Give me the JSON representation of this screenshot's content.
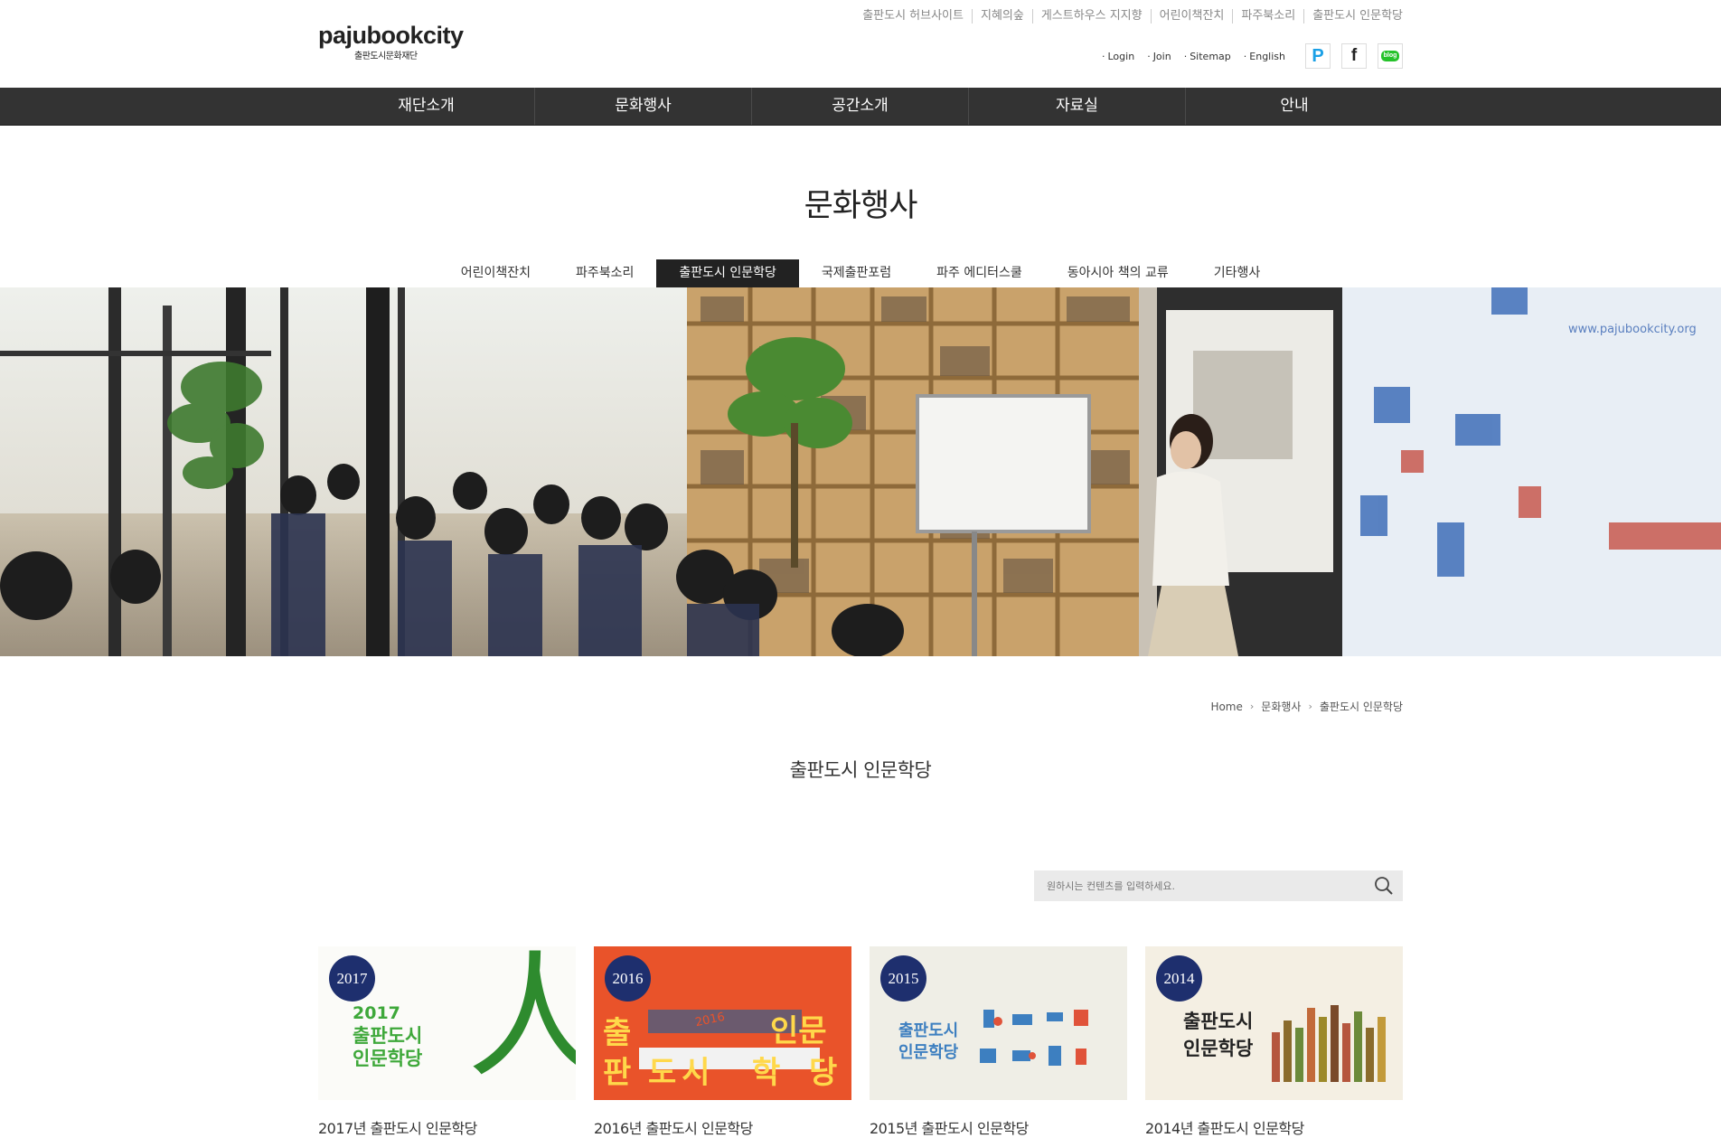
{
  "logo": {
    "main": "pajubookcity",
    "sub": "출판도시문화재단"
  },
  "top_links": [
    "출판도시 허브사이트",
    "지혜의숲",
    "게스트하우스 지지향",
    "어린이책잔치",
    "파주북소리",
    "출판도시 인문학당"
  ],
  "util_links": [
    "Login",
    "Join",
    "Sitemap",
    "English"
  ],
  "sns": {
    "p": "P",
    "f": "f",
    "blog": "blog"
  },
  "gnb": [
    "재단소개",
    "문화행사",
    "공간소개",
    "자료실",
    "안내"
  ],
  "page_title": "문화행사",
  "sub_tabs": [
    "어린이책잔치",
    "파주북소리",
    "출판도시 인문학당",
    "국제출판포럼",
    "파주 에디터스쿨",
    "동아시아 책의 교류",
    "기타행사"
  ],
  "active_sub_tab": "출판도시 인문학당",
  "hero": {
    "banner_url": "www.pajubookcity.org"
  },
  "breadcrumb": [
    "Home",
    "문화행사",
    "출판도시 인문학당"
  ],
  "section_title": "출판도시 인문학당",
  "search": {
    "placeholder": "원하시는 컨텐츠를 입력하세요."
  },
  "cards": [
    {
      "year": "2017",
      "title": "2017년 출판도시 인문학당",
      "poster_lines": [
        "2017",
        "출판도시",
        "인문학당"
      ],
      "poster_big": "人"
    },
    {
      "year": "2016",
      "title": "2016년 출판도시 인문학당",
      "poster_chars": [
        "출",
        "판",
        "도시",
        "학",
        "인문",
        "당"
      ],
      "poster_small": "2016"
    },
    {
      "year": "2015",
      "title": "2015년 출판도시 인문학당",
      "poster_lines": [
        "출판도시",
        "인문학당"
      ]
    },
    {
      "year": "2014",
      "title": "2014년 출판도시 인문학당",
      "poster_lines": [
        "출판도시",
        "인문학당"
      ]
    }
  ],
  "colors": {
    "gnb_bg": "#333333",
    "active_tab": "#222222",
    "badge": "#1e2f6e",
    "search_bg": "#eaeaea",
    "poster_2016": "#e9532a",
    "poster_2017_text": "#3ea83a",
    "poster_2015_text": "#3d7fc0"
  }
}
